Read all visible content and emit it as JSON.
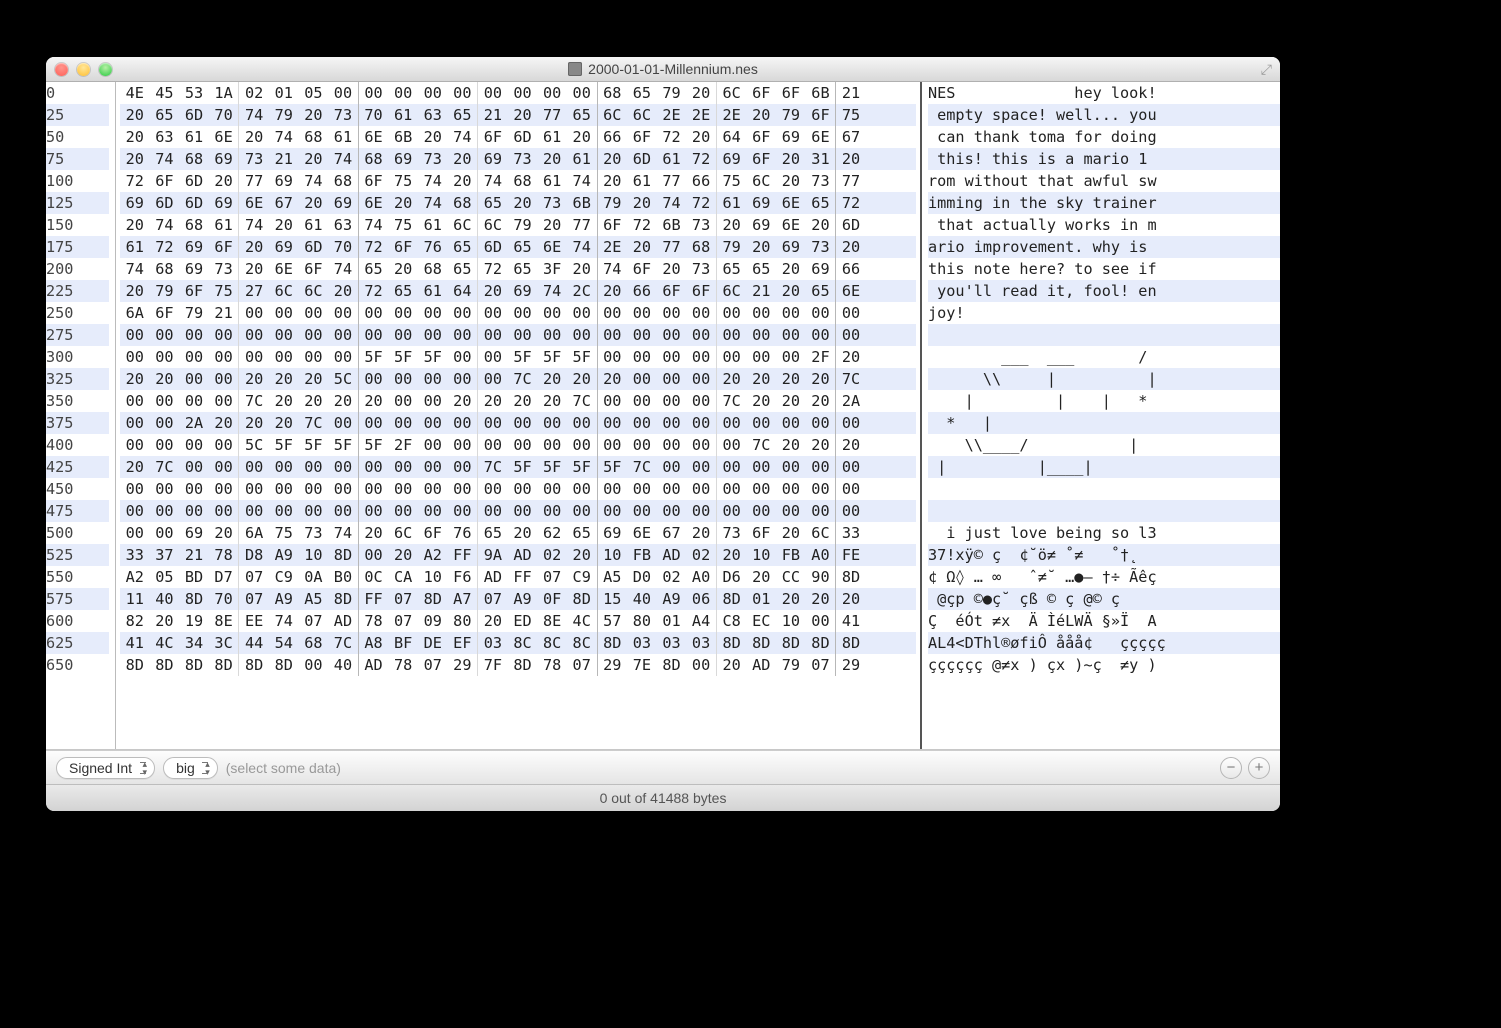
{
  "window": {
    "title": "2000-01-01-Millennium.nes"
  },
  "footer": {
    "format": "Signed Int",
    "endian": "big",
    "hint": "(select some data)"
  },
  "status": "0 out of 41488 bytes",
  "bytes_per_row": 25,
  "rows": [
    {
      "offset": 0,
      "hex": "4E 45 53 1A 02 01 05 00 00 00 00 00 00 00 00 00 68 65 79 20 6C 6F 6F 6B 21",
      "ascii": "NES             hey look!"
    },
    {
      "offset": 25,
      "hex": "20 65 6D 70 74 79 20 73 70 61 63 65 21 20 77 65 6C 6C 2E 2E 2E 20 79 6F 75",
      "ascii": " empty space! well... you"
    },
    {
      "offset": 50,
      "hex": "20 63 61 6E 20 74 68 61 6E 6B 20 74 6F 6D 61 20 66 6F 72 20 64 6F 69 6E 67",
      "ascii": " can thank toma for doing"
    },
    {
      "offset": 75,
      "hex": "20 74 68 69 73 21 20 74 68 69 73 20 69 73 20 61 20 6D 61 72 69 6F 20 31 20",
      "ascii": " this! this is a mario 1 "
    },
    {
      "offset": 100,
      "hex": "72 6F 6D 20 77 69 74 68 6F 75 74 20 74 68 61 74 20 61 77 66 75 6C 20 73 77",
      "ascii": "rom without that awful sw"
    },
    {
      "offset": 125,
      "hex": "69 6D 6D 69 6E 67 20 69 6E 20 74 68 65 20 73 6B 79 20 74 72 61 69 6E 65 72",
      "ascii": "imming in the sky trainer"
    },
    {
      "offset": 150,
      "hex": "20 74 68 61 74 20 61 63 74 75 61 6C 6C 79 20 77 6F 72 6B 73 20 69 6E 20 6D",
      "ascii": " that actually works in m"
    },
    {
      "offset": 175,
      "hex": "61 72 69 6F 20 69 6D 70 72 6F 76 65 6D 65 6E 74 2E 20 77 68 79 20 69 73 20",
      "ascii": "ario improvement. why is "
    },
    {
      "offset": 200,
      "hex": "74 68 69 73 20 6E 6F 74 65 20 68 65 72 65 3F 20 74 6F 20 73 65 65 20 69 66",
      "ascii": "this note here? to see if"
    },
    {
      "offset": 225,
      "hex": "20 79 6F 75 27 6C 6C 20 72 65 61 64 20 69 74 2C 20 66 6F 6F 6C 21 20 65 6E",
      "ascii": " you'll read it, fool! en"
    },
    {
      "offset": 250,
      "hex": "6A 6F 79 21 00 00 00 00 00 00 00 00 00 00 00 00 00 00 00 00 00 00 00 00 00",
      "ascii": "joy!                     "
    },
    {
      "offset": 275,
      "hex": "00 00 00 00 00 00 00 00 00 00 00 00 00 00 00 00 00 00 00 00 00 00 00 00 00",
      "ascii": "                         "
    },
    {
      "offset": 300,
      "hex": "00 00 00 00 00 00 00 00 5F 5F 5F 00 00 5F 5F 5F 00 00 00 00 00 00 00 2F 20",
      "ascii": "        ___  ___       / "
    },
    {
      "offset": 325,
      "hex": "20 20 00 00 20 20 20 5C 00 00 00 00 00 7C 20 20 20 00 00 00 20 20 20 20 7C",
      "ascii": "      \\\\     |          |"
    },
    {
      "offset": 350,
      "hex": "00 00 00 00 7C 20 20 20 20 00 00 20 20 20 20 7C 00 00 00 00 7C 20 20 20 2A",
      "ascii": "    |         |    |   *"
    },
    {
      "offset": 375,
      "hex": "00 00 2A 20 20 20 7C 00 00 00 00 00 00 00 00 00 00 00 00 00 00 00 00 00 00",
      "ascii": "  *   |                  "
    },
    {
      "offset": 400,
      "hex": "00 00 00 00 5C 5F 5F 5F 5F 2F 00 00 00 00 00 00 00 00 00 00 00 7C 20 20 20",
      "ascii": "    \\\\____/           |   "
    },
    {
      "offset": 425,
      "hex": "20 7C 00 00 00 00 00 00 00 00 00 00 7C 5F 5F 5F 5F 7C 00 00 00 00 00 00 00",
      "ascii": " |          |____|       "
    },
    {
      "offset": 450,
      "hex": "00 00 00 00 00 00 00 00 00 00 00 00 00 00 00 00 00 00 00 00 00 00 00 00 00",
      "ascii": "                         "
    },
    {
      "offset": 475,
      "hex": "00 00 00 00 00 00 00 00 00 00 00 00 00 00 00 00 00 00 00 00 00 00 00 00 00",
      "ascii": "                         "
    },
    {
      "offset": 500,
      "hex": "00 00 69 20 6A 75 73 74 20 6C 6F 76 65 20 62 65 69 6E 67 20 73 6F 20 6C 33",
      "ascii": "  i just love being so l3"
    },
    {
      "offset": 525,
      "hex": "33 37 21 78 D8 A9 10 8D 00 20 A2 FF 9A AD 02 20 10 FB AD 02 20 10 FB A0 FE",
      "ascii": "37!xÿ© ç  ¢˘ö≠ ˚≠   ˚†˛"
    },
    {
      "offset": 550,
      "hex": "A2 05 BD D7 07 C9 0A B0 0C CA 10 F6 AD FF 07 C9 A5 D0 02 A0 D6 20 CC 90 8D",
      "ascii": "¢ Ω◊ … ∞   ˆ≠˘ …●– †÷ Ãêç"
    },
    {
      "offset": 575,
      "hex": "11 40 8D 70 07 A9 A5 8D FF 07 8D A7 07 A9 0F 8D 15 40 A9 06 8D 01 20 20 20",
      "ascii": " @çp ©●ç˘ çß © ç @© ç    "
    },
    {
      "offset": 600,
      "hex": "82 20 19 8E EE 74 07 AD 78 07 09 80 20 ED 8E 4C 57 80 01 A4 C8 EC 10 00 41",
      "ascii": "Ç  éÓt ≠x  Ä ÌéLWÄ §»Ï  A"
    },
    {
      "offset": 625,
      "hex": "41 4C 34 3C 44 54 68 7C A8 BF DE EF 03 8C 8C 8C 8D 03 03 03 8D 8D 8D 8D 8D",
      "ascii": "AL4<DThl®øfiÔ ååå¢   ççççç"
    },
    {
      "offset": 650,
      "hex": "8D 8D 8D 8D 8D 8D 00 40 AD 78 07 29 7F 8D 78 07 29 7E 8D 00 20 AD 79 07 29",
      "ascii": "çççççç @≠x ) çx )~ç  ≠y )"
    }
  ]
}
